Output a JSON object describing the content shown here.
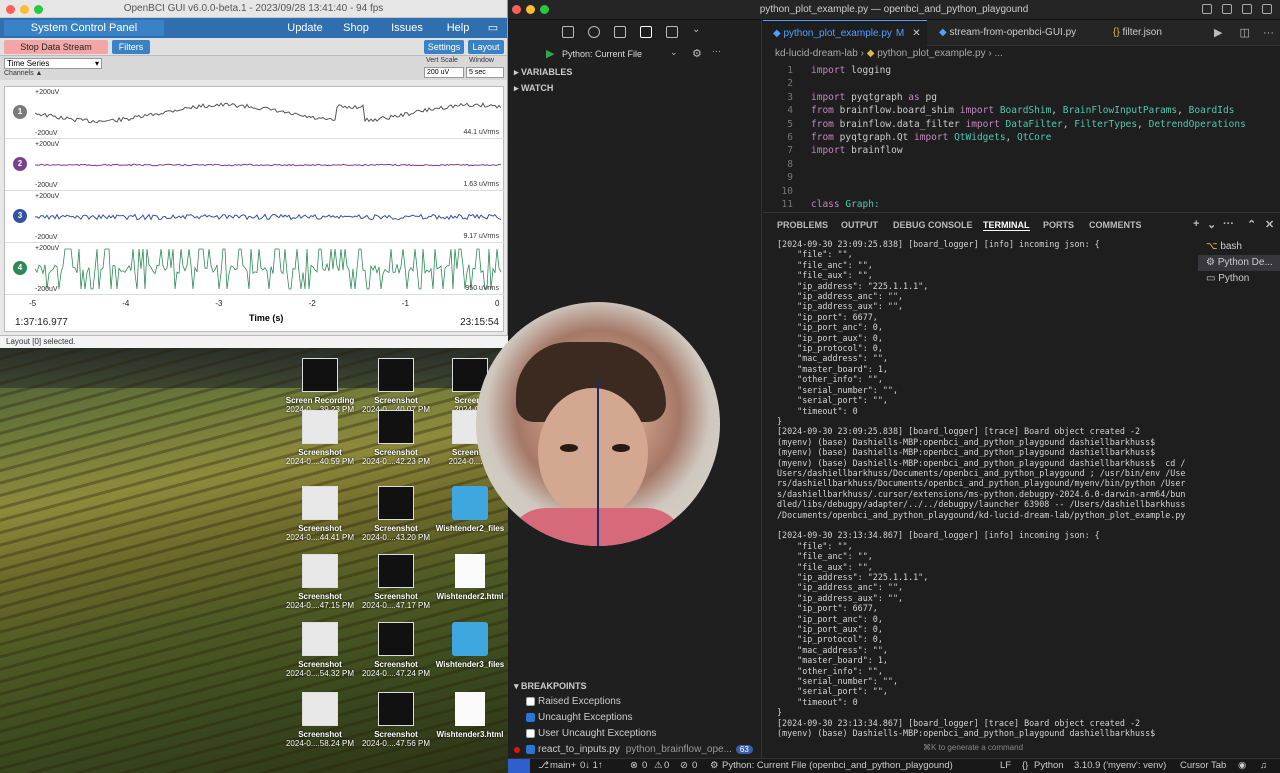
{
  "openbci": {
    "window_title": "OpenBCI GUI v6.0.0-beta.1 - 2023/09/28 13:41:40 - 94 fps",
    "menu": {
      "title": "System Control Panel",
      "update": "Update",
      "shop": "Shop",
      "issues": "Issues",
      "help": "Help"
    },
    "toolbar": {
      "stop": "Stop Data Stream",
      "filters": "Filters",
      "settings": "Settings",
      "layout": "Layout"
    },
    "widget": {
      "name": "Time Series",
      "channels": "Channels",
      "vert_scale_label": "Vert Scale",
      "window_label": "Window",
      "vert_scale": "200 uV",
      "window": "5 sec"
    },
    "channels": [
      {
        "num": "1",
        "top": "+200uV",
        "bottom": "-200uV",
        "rms": "44.1 uVrms",
        "color": "#7a7a7a"
      },
      {
        "num": "2",
        "top": "+200uV",
        "bottom": "-200uV",
        "rms": "1.63 uVrms",
        "color": "#7b3f8f"
      },
      {
        "num": "3",
        "top": "+200uV",
        "bottom": "-200uV",
        "rms": "9.17 uVrms",
        "color": "#3352a3"
      },
      {
        "num": "4",
        "top": "+200uV",
        "bottom": "-200uV",
        "rms": "950 uVrms",
        "color": "#2e8b57"
      }
    ],
    "x_ticks": [
      "-5",
      "-4",
      "-3",
      "-2",
      "-1",
      "0"
    ],
    "x_label": "Time (s)",
    "time_left": "1:37:16.977",
    "time_right": "23:15:54",
    "status": "Layout [0] selected."
  },
  "desktop": {
    "icons": [
      {
        "name": "Screen Recording",
        "sub": "2024-0....39.23 PM",
        "kind": "photo"
      },
      {
        "name": "Screenshot",
        "sub": "2024-0....40.07 PM",
        "kind": "dark"
      },
      {
        "name": "Screens",
        "sub": "2024-0...",
        "kind": "photo"
      },
      {
        "name": "Screenshot",
        "sub": "2024-0....40.59 PM",
        "kind": "light"
      },
      {
        "name": "Screenshot",
        "sub": "2024-0....42.23 PM",
        "kind": "dark"
      },
      {
        "name": "Screensh",
        "sub": "2024-0....57",
        "kind": "light"
      },
      {
        "name": "Screenshot",
        "sub": "2024-0....44.41 PM",
        "kind": "light"
      },
      {
        "name": "Screenshot",
        "sub": "2024-0....43.20 PM",
        "kind": "dark"
      },
      {
        "name": "Wishtender2_files",
        "sub": "",
        "kind": "folder"
      },
      {
        "name": "Screenshot",
        "sub": "2024-0....47.15 PM",
        "kind": "light"
      },
      {
        "name": "Screenshot",
        "sub": "2024-0....47.17 PM",
        "kind": "dark"
      },
      {
        "name": "Wishtender2.html",
        "sub": "",
        "kind": "html"
      },
      {
        "name": "Screenshot",
        "sub": "2024-0....54.32 PM",
        "kind": "light"
      },
      {
        "name": "Screenshot",
        "sub": "2024-0....47.24 PM",
        "kind": "dark"
      },
      {
        "name": "Wishtender3_files",
        "sub": "",
        "kind": "folder"
      },
      {
        "name": "Screenshot",
        "sub": "2024-0....58.24 PM",
        "kind": "light"
      },
      {
        "name": "Screenshot",
        "sub": "2024-0....47.56 PM",
        "kind": "dark"
      },
      {
        "name": "Wishtender3.html",
        "sub": "",
        "kind": "html"
      }
    ]
  },
  "vscode": {
    "window_title": "python_plot_example.py — openbci_and_python_playgound",
    "run_config": "Python: Current File",
    "sections": {
      "variables": "VARIABLES",
      "watch": "WATCH",
      "breakpoints": "BREAKPOINTS"
    },
    "breakpoints": [
      {
        "label": "Raised Exceptions",
        "checked": false
      },
      {
        "label": "Uncaught Exceptions",
        "checked": true
      },
      {
        "label": "User Uncaught Exceptions",
        "checked": false
      },
      {
        "label": "react_to_inputs.py",
        "detail": "python_brainflow_ope...",
        "count": "63",
        "checked": true
      }
    ],
    "tabs": [
      {
        "label": "python_plot_example.py",
        "flag": "M",
        "active": true
      },
      {
        "label": "stream-from-openbci-GUI.py",
        "flag": "",
        "active": false
      },
      {
        "label": "filter.json",
        "flag": "",
        "active": false
      }
    ],
    "breadcrumb": [
      "kd-lucid-dream-lab",
      "python_plot_example.py",
      "..."
    ],
    "code": [
      {
        "n": "1",
        "t": "import logging"
      },
      {
        "n": "2",
        "t": ""
      },
      {
        "n": "3",
        "t": "import pyqtgraph as pg"
      },
      {
        "n": "4",
        "t": "from brainflow.board_shim import BoardShim, BrainFlowInputParams, BoardIds"
      },
      {
        "n": "5",
        "t": "from brainflow.data_filter import DataFilter, FilterTypes, DetrendOperations"
      },
      {
        "n": "6",
        "t": "from pyqtgraph.Qt import QtWidgets, QtCore"
      },
      {
        "n": "7",
        "t": "import brainflow"
      },
      {
        "n": "8",
        "t": ""
      },
      {
        "n": "9",
        "t": ""
      },
      {
        "n": "10",
        "t": ""
      },
      {
        "n": "11",
        "t": "class Graph:"
      }
    ],
    "panel_tabs": [
      "PROBLEMS",
      "OUTPUT",
      "DEBUG CONSOLE",
      "TERMINAL",
      "PORTS",
      "COMMENTS"
    ],
    "terminal_list": [
      "bash",
      "Python De...",
      "Python"
    ],
    "terminal": "[2024-09-30 23:09:25.838] [board_logger] [info] incoming json: {\n    \"file\": \"\",\n    \"file_anc\": \"\",\n    \"file_aux\": \"\",\n    \"ip_address\": \"225.1.1.1\",\n    \"ip_address_anc\": \"\",\n    \"ip_address_aux\": \"\",\n    \"ip_port\": 6677,\n    \"ip_port_anc\": 0,\n    \"ip_port_aux\": 0,\n    \"ip_protocol\": 0,\n    \"mac_address\": \"\",\n    \"master_board\": 1,\n    \"other_info\": \"\",\n    \"serial_number\": \"\",\n    \"serial_port\": \"\",\n    \"timeout\": 0\n}\n[2024-09-30 23:09:25.838] [board_logger] [trace] Board object created -2\n(myenv) (base) Dashiells-MBP:openbci_and_python_playgound dashiellbarkhuss$\n(myenv) (base) Dashiells-MBP:openbci_and_python_playgound dashiellbarkhuss$\n(myenv) (base) Dashiells-MBP:openbci_and_python_playgound dashiellbarkhuss$  cd /\nUsers/dashiellbarkhuss/Documents/openbci_and_python_playgound ; /usr/bin/env /Use\nrs/dashiellbarkhuss/Documents/openbci_and_python_playgound/myenv/bin/python /User\ns/dashiellbarkhuss/.cursor/extensions/ms-python.debugpy-2024.6.0-darwin-arm64/bun\ndled/libs/debugpy/adapter/../../debugpy/launcher 63908 -- /Users/dashiellbarkhuss\n/Documents/openbci_and_python_playgound/kd-lucid-dream-lab/python_plot_example.py\n\n[2024-09-30 23:13:34.867] [board_logger] [info] incoming json: {\n    \"file\": \"\",\n    \"file_anc\": \"\",\n    \"file_aux\": \"\",\n    \"ip_address\": \"225.1.1.1\",\n    \"ip_address_anc\": \"\",\n    \"ip_address_aux\": \"\",\n    \"ip_port\": 6677,\n    \"ip_port_anc\": 0,\n    \"ip_port_aux\": 0,\n    \"ip_protocol\": 0,\n    \"mac_address\": \"\",\n    \"master_board\": 1,\n    \"other_info\": \"\",\n    \"serial_number\": \"\",\n    \"serial_port\": \"\",\n    \"timeout\": 0\n}\n[2024-09-30 23:13:34.867] [board_logger] [trace] Board object created -2\n(myenv) (base) Dashiells-MBP:openbci_and_python_playgound dashiellbarkhuss$ ",
    "hint": "⌘K to generate a command",
    "statusbar": {
      "branch": "main+",
      "sync": "0↓ 1↑",
      "errors": "0",
      "warnings": "0",
      "ports": "0",
      "debug": "Python: Current File (openbci_and_python_playgound)",
      "eol": "LF",
      "lang": "Python",
      "interp": "3.10.9 ('myenv': venv)",
      "cursor_tab": "Cursor Tab"
    }
  }
}
